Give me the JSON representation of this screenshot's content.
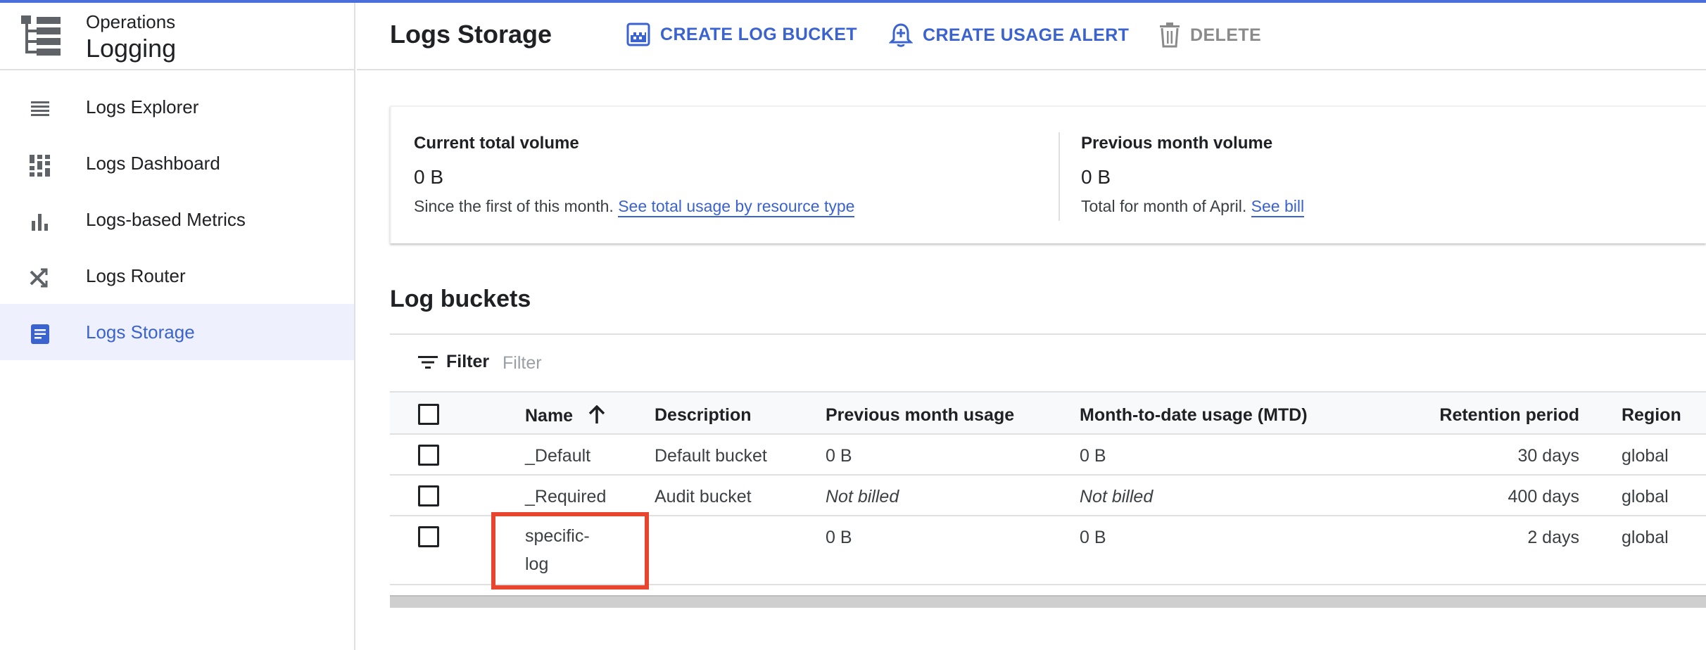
{
  "sidebar": {
    "brand": {
      "subtitle": "Operations",
      "title": "Logging",
      "icon": "logging-product-icon"
    },
    "items": [
      {
        "label": "Logs Explorer",
        "icon": "list-icon",
        "active": false
      },
      {
        "label": "Logs Dashboard",
        "icon": "dashboard-icon",
        "active": false
      },
      {
        "label": "Logs-based Metrics",
        "icon": "bar-chart-icon",
        "active": false
      },
      {
        "label": "Logs Router",
        "icon": "router-icon",
        "active": false
      },
      {
        "label": "Logs Storage",
        "icon": "storage-icon",
        "active": true
      }
    ]
  },
  "header": {
    "title": "Logs Storage",
    "actions": {
      "create_bucket": "CREATE LOG BUCKET",
      "create_alert": "CREATE USAGE ALERT",
      "delete": "DELETE"
    }
  },
  "usage": {
    "current": {
      "title": "Current total volume",
      "value": "0 B",
      "note": "Since the first of this month.",
      "link": "See total usage by resource type"
    },
    "previous": {
      "title": "Previous month volume",
      "value": "0 B",
      "note": "Total for month of April.",
      "link": "See bill"
    }
  },
  "buckets": {
    "title": "Log buckets",
    "filter_label": "Filter",
    "filter_placeholder": "Filter",
    "columns": {
      "name": "Name",
      "description": "Description",
      "prev_usage": "Previous month usage",
      "mtd_usage": "Month-to-date usage (MTD)",
      "retention": "Retention period",
      "region": "Region"
    },
    "sort": {
      "column": "name",
      "direction": "ascending",
      "icon": "arrow-up-icon"
    },
    "rows": [
      {
        "name": "_Default",
        "description": "Default bucket",
        "prev_usage": "0 B",
        "mtd_usage": "0 B",
        "retention": "30 days",
        "region": "global"
      },
      {
        "name": "_Required",
        "description": "Audit bucket",
        "prev_usage": "Not billed",
        "mtd_usage": "Not billed",
        "retention": "400 days",
        "region": "global"
      },
      {
        "name": "specific-log",
        "description": "",
        "prev_usage": "0 B",
        "mtd_usage": "0 B",
        "retention": "2 days",
        "region": "global"
      }
    ]
  },
  "colors": {
    "accent": "#3b63d0",
    "active_bg": "#eef1fd",
    "highlight": "#e8452f",
    "disabled": "#8a8a8a"
  }
}
